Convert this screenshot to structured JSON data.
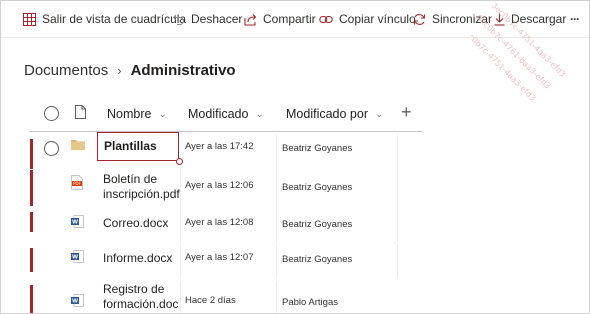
{
  "toolbar": {
    "exit_grid": "Salir de vista de cuadrícula",
    "undo": "Deshacer",
    "share": "Compartir",
    "copy_link": "Copiar vínculo",
    "sync": "Sincronizar",
    "download": "Descargar",
    "more": "···"
  },
  "breadcrumb": {
    "root": "Documentos",
    "separator": "›",
    "current": "Administrativo"
  },
  "columns": {
    "name": "Nombre",
    "modified": "Modificado",
    "modified_by": "Modificado por",
    "sort_chevron": "⌄",
    "add_column": "+"
  },
  "rows": [
    {
      "name": "Plantillas",
      "modified": "Ayer a las 17:42",
      "modified_by": "Beatriz Goyanes",
      "icon": "folder-icon"
    },
    {
      "name": "Boletín de\ninscripción.pdf",
      "modified": "Ayer a las 12:06",
      "modified_by": "Beatriz Goyanes",
      "icon": "pdf-icon"
    },
    {
      "name": "Correo.docx",
      "modified": "Ayer a las 12:08",
      "modified_by": "Beatriz Goyanes",
      "icon": "word-icon"
    },
    {
      "name": "Informe.docx",
      "modified": "Ayer a las 12:07",
      "modified_by": "Beatriz Goyanes",
      "icon": "word-icon"
    },
    {
      "name": "Registro de\nformación.doc",
      "modified": "Hace 2 días",
      "modified_by": "Pablo Artigas",
      "icon": "word-icon"
    }
  ],
  "watermark": {
    "lines": [
      "3ec0b7c-4751-4aa3-efd3",
      "9ec0b7c-4761-baa3-efd3",
      "2ec0b7c-4751-4aa3-efd3"
    ]
  },
  "colors": {
    "accent": "#a4262c",
    "folder": "#dcb67a",
    "pdf": "#d83b01",
    "word": "#2b579a"
  }
}
